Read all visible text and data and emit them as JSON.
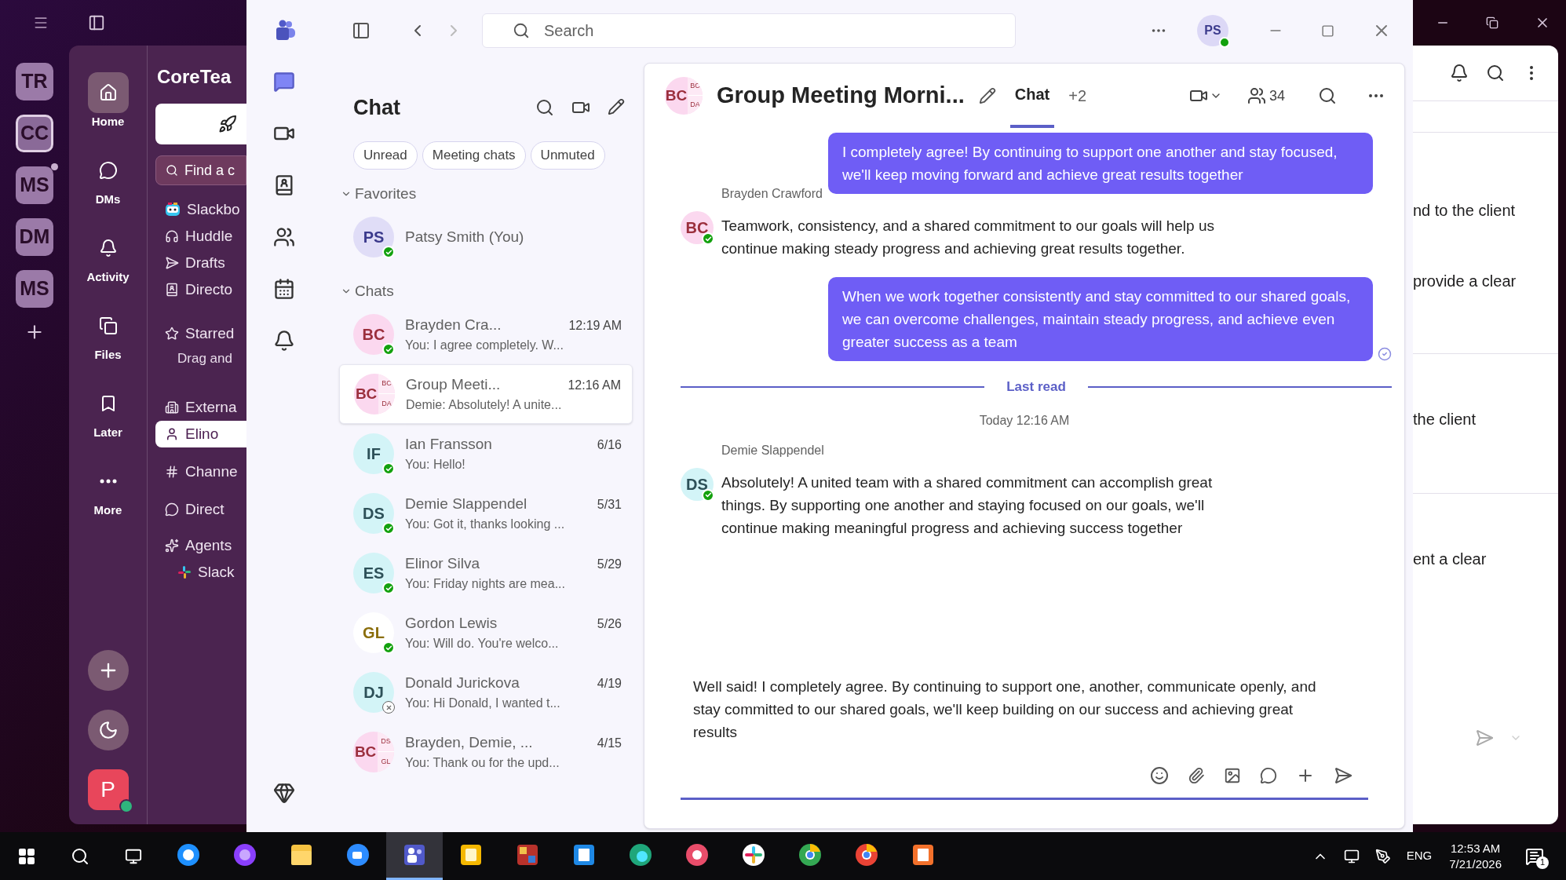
{
  "slack": {
    "workspaces": [
      {
        "initials": "TR",
        "selected": false,
        "unread": false
      },
      {
        "initials": "CC",
        "selected": true,
        "unread": false
      },
      {
        "initials": "MS",
        "selected": false,
        "unread": true
      },
      {
        "initials": "DM",
        "selected": false,
        "unread": false
      },
      {
        "initials": "MS",
        "selected": false,
        "unread": false
      }
    ],
    "nav": [
      {
        "kind": "home",
        "label": "Home",
        "selected": true
      },
      {
        "kind": "dms",
        "label": "DMs",
        "selected": false
      },
      {
        "kind": "activity",
        "label": "Activity",
        "selected": false
      },
      {
        "kind": "files",
        "label": "Files",
        "selected": false
      },
      {
        "kind": "later",
        "label": "Later",
        "selected": false
      },
      {
        "kind": "more",
        "label": "More",
        "selected": false
      }
    ],
    "user_initial": "P",
    "workspace_title": "CoreTea",
    "find_placeholder": "Find a c",
    "sidebar": [
      {
        "kind": "slackbot",
        "label": "Slackbo",
        "selected": false
      },
      {
        "kind": "huddle",
        "label": "Huddle",
        "selected": false
      },
      {
        "kind": "drafts",
        "label": "Drafts",
        "selected": false
      },
      {
        "kind": "directory",
        "label": "Directo",
        "selected": false
      },
      {
        "kind": "starred",
        "label": "Starred",
        "selected": false
      },
      {
        "kind": "hint",
        "label": "Drag and",
        "selected": false
      },
      {
        "kind": "external",
        "label": "Externa",
        "selected": false
      },
      {
        "kind": "person",
        "label": "Elino",
        "selected": true
      },
      {
        "kind": "channels",
        "label": "Channe",
        "selected": false
      },
      {
        "kind": "direct",
        "label": "Direct",
        "selected": false
      },
      {
        "kind": "agents",
        "label": "Agents",
        "selected": false
      },
      {
        "kind": "slackapp",
        "label": "Slack",
        "selected": false
      }
    ],
    "content_lines": [
      "nd to the client",
      "provide a clear",
      "the client",
      "ent a clear"
    ]
  },
  "teams": {
    "search_placeholder": "Search",
    "user_initials": "PS",
    "chat_list": {
      "title": "Chat",
      "filters": [
        "Unread",
        "Meeting chats",
        "Unmuted"
      ],
      "sections": [
        {
          "title": "Favorites",
          "expanded": true,
          "items": [
            {
              "name": "Patsy Smith (You)",
              "avatar": {
                "initials": "PS",
                "color": "#e0ddf7"
              },
              "available": true,
              "selected": false
            }
          ]
        },
        {
          "title": "Chats",
          "expanded": true,
          "items": [
            {
              "name": "Brayden Cra...",
              "time": "12:19 AM",
              "preview": "You: I agree completely. W...",
              "avatar": {
                "initials": "BC",
                "color": "#fbd8ef"
              },
              "available": true,
              "selected": false
            },
            {
              "name": "Group Meeti...",
              "time": "12:16 AM",
              "preview": "Demie: Absolutely! A unite...",
              "avatar": {
                "initials": "BC",
                "color": "#fbd8ef",
                "sub": [
                  "BC",
                  "DA"
                ]
              },
              "selected": true
            },
            {
              "name": "Ian Fransson",
              "time": "6/16",
              "preview": "You: Hello!",
              "avatar": {
                "initials": "IF",
                "color": "#d3f4f7"
              },
              "available": true,
              "selected": false
            },
            {
              "name": "Demie Slappendel",
              "time": "5/31",
              "preview": "You: Got it, thanks looking ...",
              "avatar": {
                "initials": "DS",
                "color": "#d3f4f7"
              },
              "available": true,
              "selected": false
            },
            {
              "name": "Elinor Silva",
              "time": "5/29",
              "preview": "You: Friday nights are mea...",
              "avatar": {
                "initials": "ES",
                "color": "#d3f4f7"
              },
              "available": true,
              "selected": false
            },
            {
              "name": "Gordon Lewis",
              "time": "5/26",
              "preview": "You: Will do. You're welco...",
              "avatar": {
                "initials": "GL",
                "color": "#ffffff"
              },
              "available": true,
              "selected": false
            },
            {
              "name": "Donald Jurickova",
              "time": "4/19",
              "preview": "You: Hi Donald, I wanted t...",
              "avatar": {
                "initials": "DJ",
                "color": "#d3f4f7"
              },
              "available": false,
              "selected": false
            },
            {
              "name": "Brayden, Demie, ...",
              "time": "4/15",
              "preview": "You: Thank ou for the upd...",
              "avatar": {
                "initials": "BC",
                "color": "#fbd8ef",
                "sub": [
                  "DS",
                  "GL"
                ]
              },
              "selected": false
            }
          ]
        }
      ]
    },
    "conversation": {
      "title": "Group Meeting Morni...",
      "avatar": {
        "initials": "BC",
        "color": "#fbd8ef",
        "sub": [
          "BC",
          "DA"
        ]
      },
      "tabs": [
        {
          "label": "Chat",
          "selected": true
        }
      ],
      "more_tabs": "+2",
      "participants": "34",
      "messages": [
        {
          "kind": "own",
          "text": "I completely agree! By continuing to support one another and stay focused, we'll keep moving forward and achieve great results together",
          "seen": false
        },
        {
          "kind": "other",
          "sender": "Brayden Crawford",
          "avatar": {
            "initials": "BC",
            "color": "#fbd8ef"
          },
          "text": "Teamwork, consistency, and a shared commitment to our goals will help us continue making steady progress and achieving great results together."
        },
        {
          "kind": "own",
          "text": "When we work together consistently and stay committed to our shared goals, we can overcome challenges, maintain steady progress, and achieve even greater success as a team",
          "seen": true
        },
        {
          "kind": "divider",
          "label": "Last read"
        },
        {
          "kind": "timestamp",
          "label": "Today 12:16 AM"
        },
        {
          "kind": "other",
          "sender": "Demie Slappendel",
          "avatar": {
            "initials": "DS",
            "color": "#d3f4f7"
          },
          "text": "Absolutely! A united team with a shared commitment can accomplish great things. By supporting one another and staying focused on our goals, we'll continue making meaningful progress and achieving success together"
        }
      ],
      "draft": "Well said! I completely agree. By continuing to support one, another, communicate openly, and stay committed to our shared goals, we'll keep building on our success and achieving great results"
    }
  },
  "taskbar": {
    "apps": [
      {
        "kind": "ie",
        "selected": false
      },
      {
        "kind": "orb",
        "selected": false
      },
      {
        "kind": "folder",
        "selected": false
      },
      {
        "kind": "zoom",
        "selected": false
      },
      {
        "kind": "teams",
        "selected": true
      },
      {
        "kind": "notes",
        "selected": false
      },
      {
        "kind": "winrar",
        "selected": false
      },
      {
        "kind": "doc",
        "selected": false
      },
      {
        "kind": "edge",
        "selected": false
      },
      {
        "kind": "snip",
        "selected": false
      },
      {
        "kind": "slack",
        "selected": false
      },
      {
        "kind": "chrome",
        "selected": false
      },
      {
        "kind": "chrome-profile",
        "selected": false
      },
      {
        "kind": "slides",
        "selected": false
      }
    ],
    "language": "ENG",
    "time": "12:53 AM",
    "date": "7/21/2026",
    "notifications": "1"
  }
}
